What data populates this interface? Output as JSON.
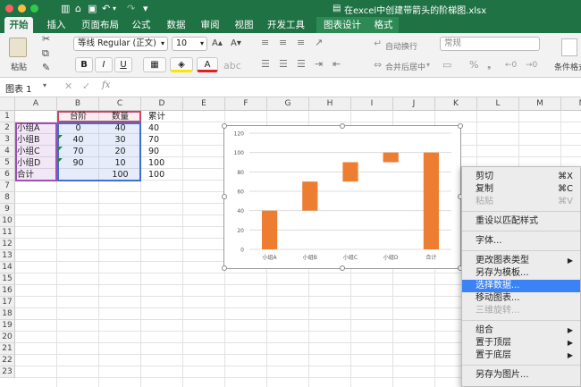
{
  "window": {
    "title": "在excel中创建带箭头的阶梯图.xlsx"
  },
  "tabs": [
    {
      "label": "开始",
      "active": true
    },
    {
      "label": "插入"
    },
    {
      "label": "页面布局"
    },
    {
      "label": "公式"
    },
    {
      "label": "数据"
    },
    {
      "label": "审阅"
    },
    {
      "label": "视图"
    },
    {
      "label": "开发工具"
    },
    {
      "label": "图表设计",
      "contextual": true
    },
    {
      "label": "格式",
      "contextual": true
    }
  ],
  "ribbon": {
    "paste_label": "粘贴",
    "font_name": "等线 Regular (正文)",
    "font_size": "10",
    "bold": "B",
    "italic": "I",
    "underline": "U",
    "font_color_letter": "A",
    "wrap_text": "自动换行",
    "merge_center": "合并后居中",
    "number_format": "常规",
    "cond_format": "条件格式"
  },
  "formula_bar": {
    "name_box": "图表 1",
    "fx": "fx",
    "value": ""
  },
  "columns": [
    "A",
    "B",
    "C",
    "D",
    "E",
    "F",
    "G",
    "H",
    "I",
    "J",
    "K",
    "L",
    "M",
    "N"
  ],
  "rows": [
    "1",
    "2",
    "3",
    "4",
    "5",
    "6",
    "7",
    "8",
    "9",
    "10",
    "11",
    "12",
    "13",
    "14",
    "15",
    "16",
    "17",
    "18",
    "19",
    "20",
    "21",
    "22",
    "23"
  ],
  "table": {
    "headers": [
      "",
      "台阶",
      "数量",
      "累计"
    ],
    "rows": [
      [
        "小组A",
        "0",
        "40",
        "40"
      ],
      [
        "小组B",
        "40",
        "30",
        "70"
      ],
      [
        "小组C",
        "70",
        "20",
        "90"
      ],
      [
        "小组D",
        "90",
        "10",
        "100"
      ],
      [
        "合计",
        "",
        "100",
        "100"
      ]
    ]
  },
  "chart_data": {
    "type": "bar",
    "subtype": "stacked-waterfall",
    "categories": [
      "小组A",
      "小组B",
      "小组C",
      "小组D",
      "合计"
    ],
    "series": [
      {
        "values": [
          0,
          40,
          70,
          90,
          0
        ],
        "color": "none"
      },
      {
        "values": [
          40,
          30,
          20,
          10,
          100
        ],
        "color": "#ed7d31"
      }
    ],
    "y_ticks": [
      "0",
      "20",
      "40",
      "60",
      "80",
      "100",
      "120"
    ],
    "ylim": [
      0,
      120
    ],
    "grid": true,
    "title": "",
    "xlabel": "",
    "ylabel": ""
  },
  "context_menu": {
    "items": [
      {
        "label": "剪切",
        "shortcut": "⌘X"
      },
      {
        "label": "复制",
        "shortcut": "⌘C"
      },
      {
        "label": "粘贴",
        "shortcut": "⌘V",
        "disabled": true
      },
      {
        "separator": true
      },
      {
        "label": "重设以匹配样式"
      },
      {
        "separator": true
      },
      {
        "label": "字体..."
      },
      {
        "separator": true
      },
      {
        "label": "更改图表类型",
        "submenu": "▶"
      },
      {
        "label": "另存为模板..."
      },
      {
        "label": "选择数据...",
        "highlighted": true
      },
      {
        "label": "移动图表..."
      },
      {
        "label": "三维旋转...",
        "disabled": true
      },
      {
        "separator": true
      },
      {
        "label": "组合",
        "submenu": "▶"
      },
      {
        "label": "置于顶层",
        "submenu": "▶"
      },
      {
        "label": "置于底层",
        "submenu": "▶"
      },
      {
        "separator": true
      },
      {
        "label": "另存为图片..."
      }
    ]
  },
  "colors": {
    "excel_green": "#1f7244",
    "bar_orange": "#ed7d31",
    "menu_highlight": "#3b82f6"
  }
}
